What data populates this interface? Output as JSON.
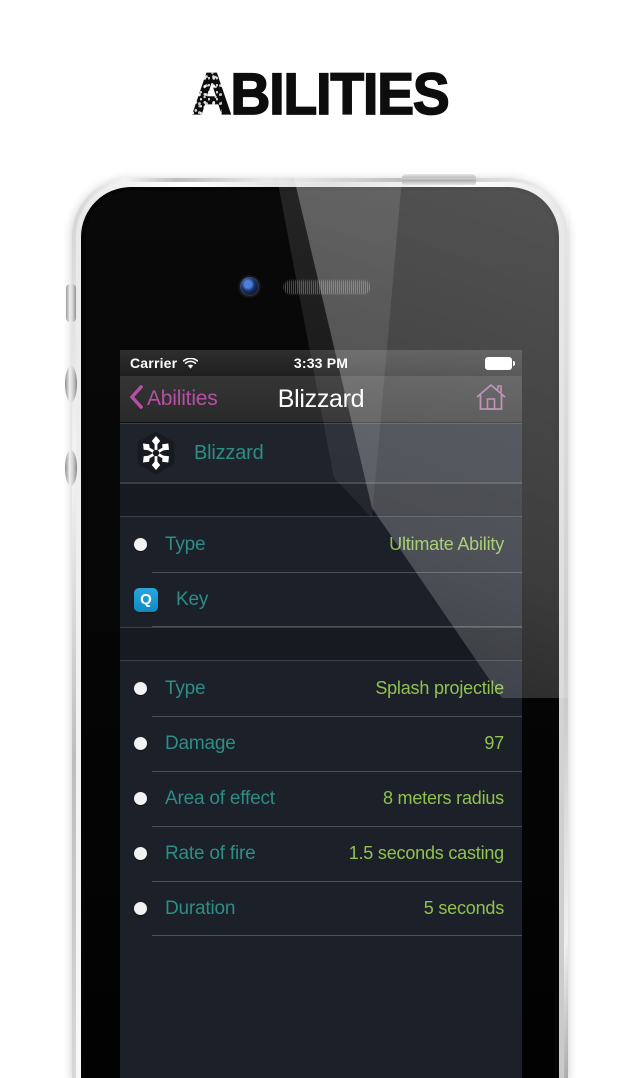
{
  "page": {
    "title": "ABILITIES"
  },
  "status_bar": {
    "carrier": "Carrier",
    "wifi_icon": "wifi-icon",
    "time": "3:33 PM",
    "battery_icon": "battery-icon"
  },
  "nav_bar": {
    "back_icon": "chevron-left-icon",
    "back_label": "Abilities",
    "title": "Blizzard",
    "home_icon": "home-icon"
  },
  "hero": {
    "icon": "snowflake-icon",
    "name": "Blizzard"
  },
  "sections": [
    {
      "rows": [
        {
          "marker": "bullet",
          "label": "Type",
          "value": "Ultimate Ability"
        },
        {
          "marker": "key",
          "key": "Q",
          "label": "Key",
          "value": ""
        }
      ]
    },
    {
      "rows": [
        {
          "marker": "bullet",
          "label": "Type",
          "value": "Splash projectile"
        },
        {
          "marker": "bullet",
          "label": "Damage",
          "value": "97"
        },
        {
          "marker": "bullet",
          "label": "Area of effect",
          "value": "8 meters radius"
        },
        {
          "marker": "bullet",
          "label": "Rate of fire",
          "value": "1.5 seconds casting"
        },
        {
          "marker": "bullet",
          "label": "Duration",
          "value": "5 seconds"
        }
      ]
    }
  ],
  "colors": {
    "accent_pink": "#b84fa4",
    "label_teal": "#2e8d86",
    "value_green": "#91c24f",
    "key_badge_blue": "#1b9ad4",
    "screen_background": "#1c2029",
    "separator": "#4b5058"
  }
}
